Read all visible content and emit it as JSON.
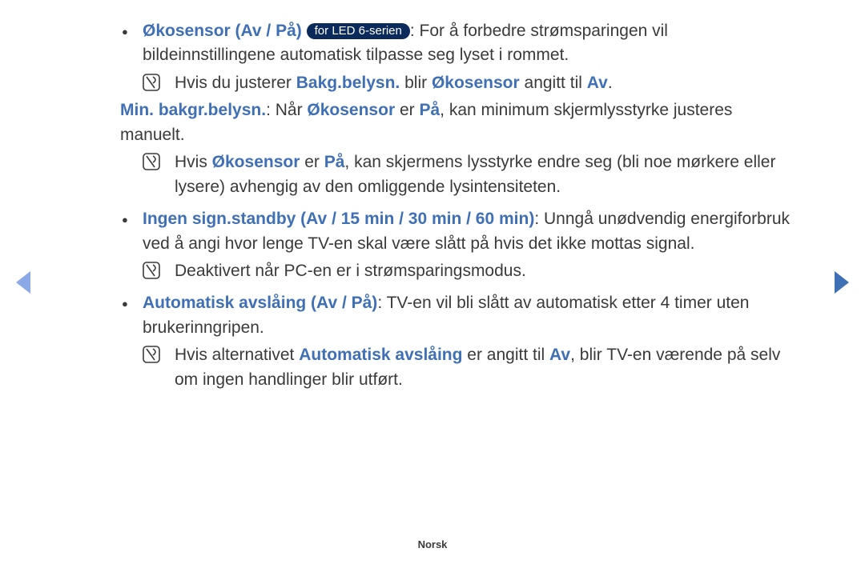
{
  "footer": {
    "lang": "Norsk"
  },
  "badge": {
    "led6": "for LED 6-serien"
  },
  "bullet1": {
    "term": "Økosensor (Av / På)",
    "rest": ": For å forbedre strømsparingen vil bildeinnstillingene automatisk tilpasse seg lyset i rommet.",
    "note": {
      "pre": "Hvis du justerer ",
      "t1": "Bakg.belysn.",
      "mid": " blir ",
      "t2": "Økosensor",
      "mid2": " angitt til ",
      "t3": "Av",
      "post": "."
    },
    "sub": {
      "term": "Min. bakgr.belysn.",
      "pre": ": Når ",
      "t1": "Økosensor",
      "mid": " er ",
      "t2": "På",
      "post": ", kan minimum skjermlysstyrke justeres manuelt."
    },
    "note2": {
      "pre": "Hvis ",
      "t1": "Økosensor",
      "mid": " er ",
      "t2": "På",
      "post": ", kan skjermens lysstyrke endre seg (bli noe mørkere eller lysere) avhengig av den omliggende lysintensiteten."
    }
  },
  "bullet2": {
    "term": "Ingen sign.standby (Av / 15 min / 30 min / 60 min)",
    "rest": ": Unngå unødvendig energiforbruk ved å angi hvor lenge TV-en skal være slått på hvis det ikke mottas signal.",
    "note": {
      "text": "Deaktivert når PC-en er i strømsparingsmodus."
    }
  },
  "bullet3": {
    "term": "Automatisk avslåing (Av / På)",
    "rest": ": TV-en vil bli slått av automatisk etter 4 timer uten brukerinngripen.",
    "note": {
      "pre": "Hvis alternativet ",
      "t1": "Automatisk avslåing",
      "mid": " er angitt til ",
      "t2": "Av",
      "post": ", blir TV-en værende på selv om ingen handlinger blir utført."
    }
  }
}
